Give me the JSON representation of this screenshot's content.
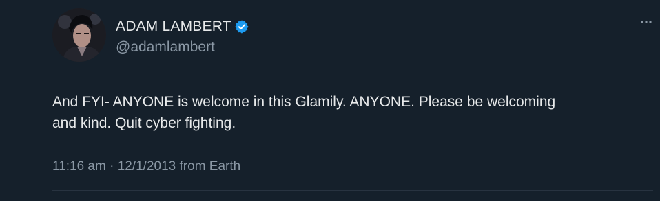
{
  "tweet": {
    "display_name": "ADAM LAMBERT",
    "handle": "@adamlambert",
    "verified": true,
    "text_line1": "And FYI- ANYONE is welcome in this Glamily. ANYONE. Please be welcoming",
    "text_line2": "and kind. Quit cyber fighting.",
    "time": "11:16 am",
    "separator": "·",
    "date": "12/1/2013",
    "source": "from Earth"
  },
  "icons": {
    "avatar": "profile-photo",
    "verified": "verified-badge-icon",
    "more": "more-options-icon"
  },
  "colors": {
    "background": "#15202b",
    "text": "#e7e9ea",
    "secondary": "#8b98a5",
    "verified": "#1d9bf0"
  }
}
